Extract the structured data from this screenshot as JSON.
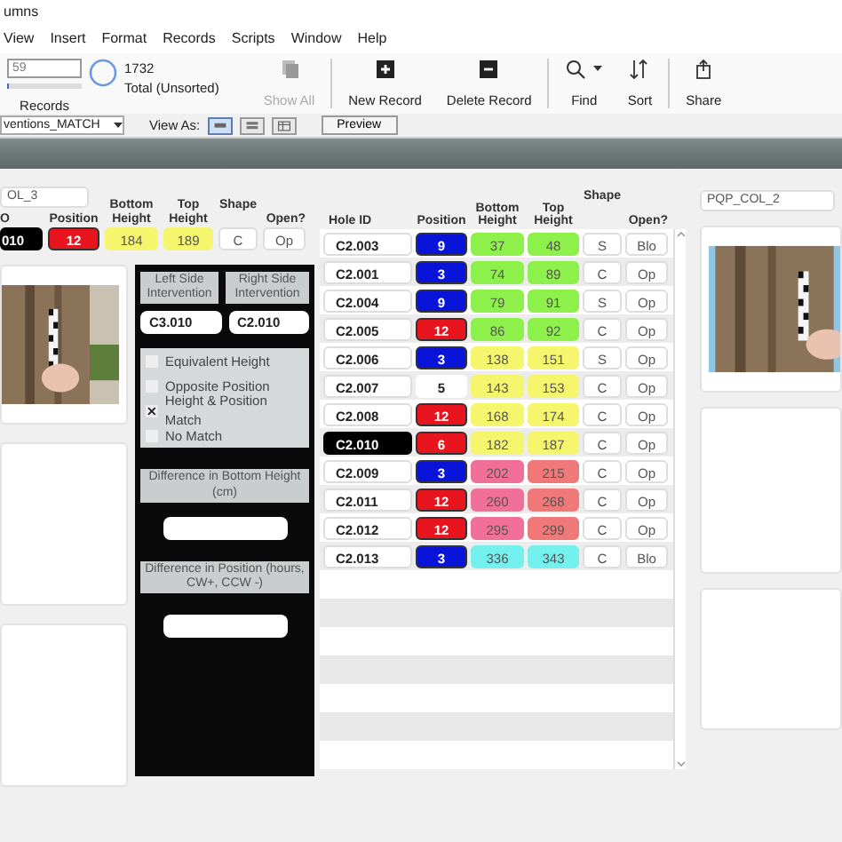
{
  "window": {
    "title": "umns"
  },
  "menu": [
    "View",
    "Insert",
    "Format",
    "Records",
    "Scripts",
    "Window",
    "Help"
  ],
  "toolbar": {
    "record_field": "59",
    "records_slider": {
      "level": 0.03
    },
    "records_label": "Records",
    "found_count": "1732",
    "total_label": "Total (Unsorted)",
    "buttons": [
      {
        "kind": "show-all",
        "label": "Show All",
        "disabled": true
      },
      {
        "kind": "new",
        "label": "New Record",
        "disabled": false
      },
      {
        "kind": "delete",
        "label": "Delete Record",
        "disabled": false
      },
      {
        "kind": "find",
        "label": "Find",
        "disabled": false
      },
      {
        "kind": "sort",
        "label": "Sort",
        "disabled": false
      },
      {
        "kind": "share",
        "label": "Share",
        "disabled": false
      }
    ]
  },
  "layout_bar": {
    "layout": "ventions_MATCH",
    "view_as_label": "View As:",
    "view_as": [
      {
        "kind": "form",
        "selected": true
      },
      {
        "kind": "list",
        "selected": false
      },
      {
        "kind": "table",
        "selected": false
      }
    ],
    "preview": "Preview"
  },
  "left_record": {
    "column_name": "OL_3",
    "headers": [
      "O",
      "Position",
      "Bottom Height",
      "Top Height",
      "Shape",
      "Open?"
    ],
    "hole_id": "010",
    "selected": true,
    "position": {
      "text": "12",
      "color": "#e8141e"
    },
    "bottom_height": {
      "text": "184",
      "color": "#f5f56e"
    },
    "top_height": {
      "text": "189",
      "color": "#f5f56e"
    },
    "shape": "C",
    "open": "Op"
  },
  "intervention_panel": {
    "left_label": "Left Side Intervention",
    "right_label": "Right Side Intervention",
    "left_value": "C3.010",
    "right_value": "C2.010",
    "options": [
      {
        "label": "Equivalent Height",
        "checked": false
      },
      {
        "label": "Opposite Position",
        "checked": false
      },
      {
        "label": "Height & Position Match",
        "checked": true
      },
      {
        "label": "No Match",
        "checked": false
      }
    ],
    "bottom_diff_label": "Difference in Bottom Height (cm)",
    "position_diff_label": "Difference in Position (hours, CW+, CCW -)"
  },
  "table": {
    "columns": [
      "Hole ID",
      "Position",
      "Bottom Height",
      "Top Height",
      "Shape",
      "Open?"
    ],
    "rows": [
      {
        "hole_id": "C2.003",
        "selected": false,
        "position": {
          "text": "9",
          "color": "#0a14d8"
        },
        "bottom_height": {
          "text": "37",
          "color": "#8ef04a"
        },
        "top_height": {
          "text": "48",
          "color": "#8ef04a"
        },
        "shape": "S",
        "open": "Blo"
      },
      {
        "hole_id": "C2.001",
        "selected": false,
        "position": {
          "text": "3",
          "color": "#0a14d8"
        },
        "bottom_height": {
          "text": "74",
          "color": "#8ef04a"
        },
        "top_height": {
          "text": "89",
          "color": "#8ef04a"
        },
        "shape": "C",
        "open": "Op"
      },
      {
        "hole_id": "C2.004",
        "selected": false,
        "position": {
          "text": "9",
          "color": "#0a14d8"
        },
        "bottom_height": {
          "text": "79",
          "color": "#8ef04a"
        },
        "top_height": {
          "text": "91",
          "color": "#8ef04a"
        },
        "shape": "S",
        "open": "Op"
      },
      {
        "hole_id": "C2.005",
        "selected": false,
        "position": {
          "text": "12",
          "color": "#e8141e"
        },
        "bottom_height": {
          "text": "86",
          "color": "#8ef04a"
        },
        "top_height": {
          "text": "92",
          "color": "#8ef04a"
        },
        "shape": "C",
        "open": "Op"
      },
      {
        "hole_id": "C2.006",
        "selected": false,
        "position": {
          "text": "3",
          "color": "#0a14d8"
        },
        "bottom_height": {
          "text": "138",
          "color": "#f5f56e"
        },
        "top_height": {
          "text": "151",
          "color": "#f5f56e"
        },
        "shape": "S",
        "open": "Op"
      },
      {
        "hole_id": "C2.007",
        "selected": false,
        "position": {
          "text": "5",
          "color": "#ffffff"
        },
        "bottom_height": {
          "text": "143",
          "color": "#f5f56e"
        },
        "top_height": {
          "text": "153",
          "color": "#f5f56e"
        },
        "shape": "C",
        "open": "Op"
      },
      {
        "hole_id": "C2.008",
        "selected": false,
        "position": {
          "text": "12",
          "color": "#e8141e"
        },
        "bottom_height": {
          "text": "168",
          "color": "#f5f56e"
        },
        "top_height": {
          "text": "174",
          "color": "#f5f56e"
        },
        "shape": "C",
        "open": "Op"
      },
      {
        "hole_id": "C2.010",
        "selected": true,
        "position": {
          "text": "6",
          "color": "#e8141e"
        },
        "bottom_height": {
          "text": "182",
          "color": "#f5f56e"
        },
        "top_height": {
          "text": "187",
          "color": "#f5f56e"
        },
        "shape": "C",
        "open": "Op"
      },
      {
        "hole_id": "C2.009",
        "selected": false,
        "position": {
          "text": "3",
          "color": "#0a14d8"
        },
        "bottom_height": {
          "text": "202",
          "color": "#f0709a"
        },
        "top_height": {
          "text": "215",
          "color": "#f07878"
        },
        "shape": "C",
        "open": "Op"
      },
      {
        "hole_id": "C2.011",
        "selected": false,
        "position": {
          "text": "12",
          "color": "#e8141e"
        },
        "bottom_height": {
          "text": "260",
          "color": "#f0709a"
        },
        "top_height": {
          "text": "268",
          "color": "#f07878"
        },
        "shape": "C",
        "open": "Op"
      },
      {
        "hole_id": "C2.012",
        "selected": false,
        "position": {
          "text": "12",
          "color": "#e8141e"
        },
        "bottom_height": {
          "text": "295",
          "color": "#f0709a"
        },
        "top_height": {
          "text": "299",
          "color": "#f07878"
        },
        "shape": "C",
        "open": "Op"
      },
      {
        "hole_id": "C2.013",
        "selected": false,
        "position": {
          "text": "3",
          "color": "#0a14d8"
        },
        "bottom_height": {
          "text": "336",
          "color": "#74f0ee"
        },
        "top_height": {
          "text": "343",
          "color": "#74f0ee"
        },
        "shape": "C",
        "open": "Blo"
      }
    ]
  },
  "right_record": {
    "column_name": "PQP_COL_2"
  }
}
